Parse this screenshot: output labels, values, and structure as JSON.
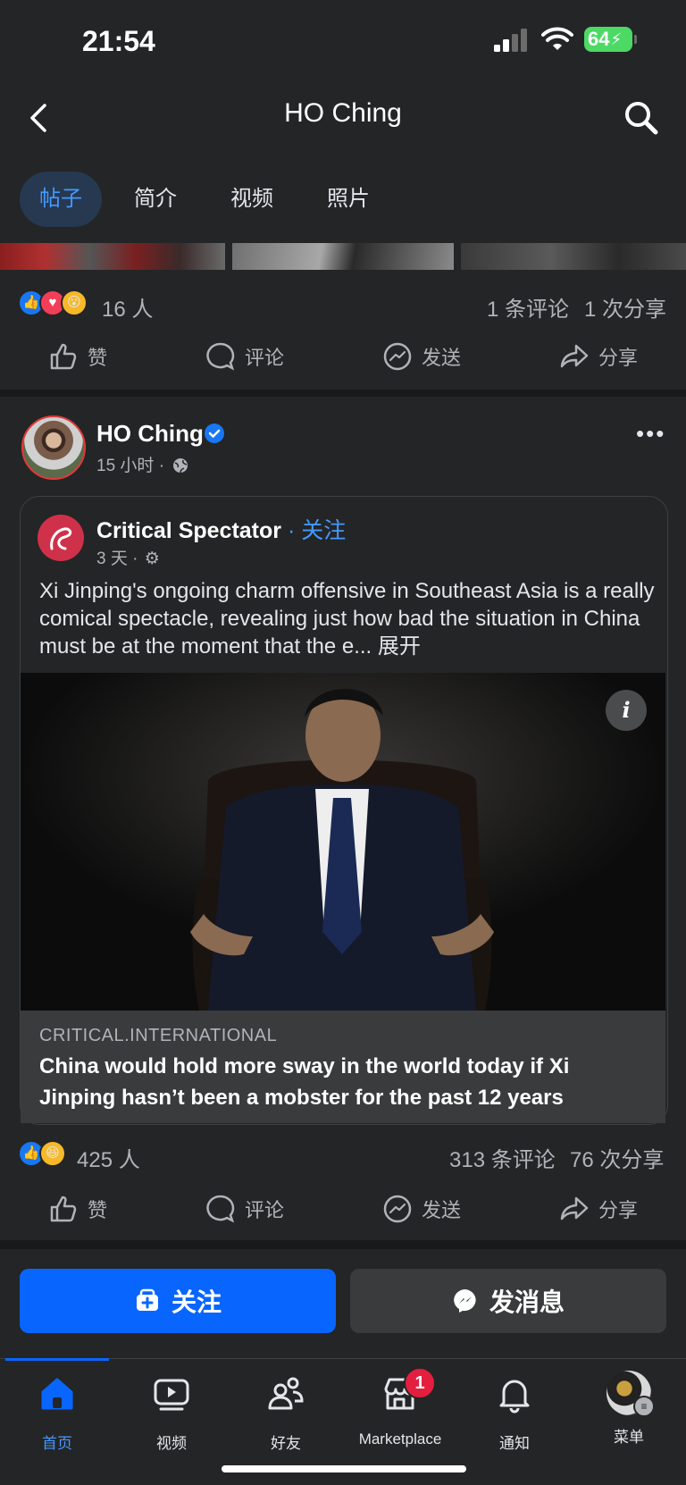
{
  "status_bar": {
    "time": "21:54",
    "battery": "64"
  },
  "header": {
    "title": "HO Ching"
  },
  "tabs": [
    {
      "label": "帖子",
      "active": true
    },
    {
      "label": "简介",
      "active": false
    },
    {
      "label": "视频",
      "active": false
    },
    {
      "label": "照片",
      "active": false
    }
  ],
  "prev_post": {
    "reaction_count": "16 人",
    "comments": "1 条评论",
    "shares": "1 次分享"
  },
  "actions": {
    "like": "赞",
    "comment": "评论",
    "send": "发送",
    "share": "分享"
  },
  "post": {
    "author": "HO Ching",
    "time": "15 小时 ·",
    "shared": {
      "page_name": "Critical Spectator",
      "follow": "· 关注",
      "time": "3 天 ·",
      "text": "Xi Jinping's ongoing charm offensive in Southeast Asia is a really comical spectacle, revealing just how bad the situation in China must be at the moment that the e...",
      "expand": "展开",
      "link_domain": "CRITICAL.INTERNATIONAL",
      "link_title": "China would hold more sway in the world today if Xi Jinping hasn’t been a mobster for the past 12 years"
    },
    "reaction_count": "425 人",
    "comments": "313 条评论",
    "shares": "76 次分享"
  },
  "buttons": {
    "follow": "关注",
    "message": "发消息"
  },
  "bottom_nav": [
    {
      "label": "首页",
      "icon": "home-icon",
      "active": true
    },
    {
      "label": "视频",
      "icon": "video-icon",
      "active": false
    },
    {
      "label": "好友",
      "icon": "friends-icon",
      "active": false
    },
    {
      "label": "Marketplace",
      "icon": "marketplace-icon",
      "active": false,
      "badge": "1"
    },
    {
      "label": "通知",
      "icon": "bell-icon",
      "active": false
    },
    {
      "label": "菜单",
      "icon": "menu-avatar",
      "active": false
    }
  ],
  "colors": {
    "accent": "#0866ff",
    "link_blue": "#4599ff",
    "background": "#242526"
  }
}
